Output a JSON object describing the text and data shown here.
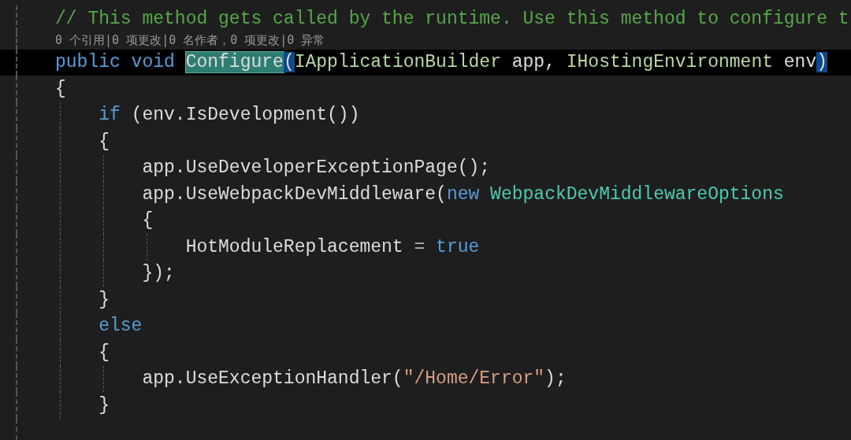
{
  "editor": {
    "lines": [
      {
        "kind": "code",
        "current": false,
        "tokens": [
          {
            "kind": "comment",
            "text": "// This method gets called by the runtime. Use this method to configure t"
          }
        ]
      },
      {
        "kind": "codelens",
        "current": false,
        "tokens": [
          {
            "kind": "codelens",
            "text": "0 个引用|0 项更改|0 名作者，0 项更改|0 异常"
          }
        ]
      },
      {
        "kind": "code",
        "current": true,
        "tokens": [
          {
            "kind": "keyword",
            "text": "public void ",
            "selected": false,
            "brace_matched": false
          },
          {
            "kind": "plain",
            "text": "Configure",
            "selected": true,
            "brace_matched": false
          },
          {
            "kind": "plain",
            "text": "(",
            "selected": false,
            "brace_matched": true
          },
          {
            "kind": "interface",
            "text": "IApplicationBuilder",
            "selected": false,
            "brace_matched": false
          },
          {
            "kind": "plain",
            "text": " app, ",
            "selected": false,
            "brace_matched": false
          },
          {
            "kind": "interface",
            "text": "IHostingEnvironment",
            "selected": false,
            "brace_matched": false
          },
          {
            "kind": "plain",
            "text": " env",
            "selected": false,
            "brace_matched": false
          },
          {
            "kind": "plain",
            "text": ")",
            "selected": false,
            "brace_matched": true
          }
        ]
      },
      {
        "kind": "code",
        "current": false,
        "tokens": [
          {
            "kind": "plain",
            "text": "{"
          }
        ]
      },
      {
        "kind": "code",
        "current": false,
        "tokens": [
          {
            "kind": "keyword",
            "text": "    if"
          },
          {
            "kind": "plain",
            "text": " (env.IsDevelopment())"
          }
        ]
      },
      {
        "kind": "code",
        "current": false,
        "tokens": [
          {
            "kind": "plain",
            "text": "    {"
          }
        ]
      },
      {
        "kind": "code",
        "current": false,
        "tokens": [
          {
            "kind": "plain",
            "text": "        app.UseDeveloperExceptionPage();"
          }
        ]
      },
      {
        "kind": "code",
        "current": false,
        "tokens": [
          {
            "kind": "plain",
            "text": "        app.UseWebpackDevMiddleware("
          },
          {
            "kind": "keyword",
            "text": "new"
          },
          {
            "kind": "type",
            "text": " WebpackDevMiddlewareOptions"
          }
        ]
      },
      {
        "kind": "code",
        "current": false,
        "tokens": [
          {
            "kind": "plain",
            "text": "        {"
          }
        ]
      },
      {
        "kind": "code",
        "current": false,
        "tokens": [
          {
            "kind": "plain",
            "text": "            HotModuleReplacement "
          },
          {
            "kind": "operator",
            "text": "="
          },
          {
            "kind": "keyword",
            "text": " true"
          }
        ]
      },
      {
        "kind": "code",
        "current": false,
        "tokens": [
          {
            "kind": "plain",
            "text": "        });"
          }
        ]
      },
      {
        "kind": "code",
        "current": false,
        "tokens": [
          {
            "kind": "plain",
            "text": "    }"
          }
        ]
      },
      {
        "kind": "code",
        "current": false,
        "tokens": [
          {
            "kind": "keyword",
            "text": "    else"
          }
        ]
      },
      {
        "kind": "code",
        "current": false,
        "tokens": [
          {
            "kind": "plain",
            "text": "    {"
          }
        ]
      },
      {
        "kind": "code",
        "current": false,
        "tokens": [
          {
            "kind": "plain",
            "text": "        app.UseExceptionHandler("
          },
          {
            "kind": "string",
            "text": "\"/Home/Error\""
          },
          {
            "kind": "plain",
            "text": ");"
          }
        ]
      },
      {
        "kind": "code",
        "current": false,
        "tokens": [
          {
            "kind": "plain",
            "text": "    }"
          }
        ]
      }
    ]
  }
}
